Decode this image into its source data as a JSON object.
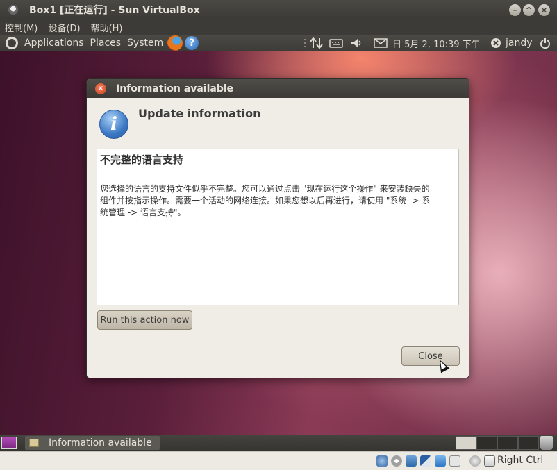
{
  "window": {
    "title": "Box1 [正在运行] - Sun VirtualBox",
    "controls": [
      "minimize",
      "maximize",
      "close"
    ]
  },
  "vbox_menu": {
    "items": [
      "控制(M)",
      "设备(D)",
      "帮助(H)"
    ]
  },
  "top_panel": {
    "applications": "Applications",
    "places": "Places",
    "system": "System",
    "clock": "日 5月 2, 10:39 下午",
    "user": "jandy",
    "help_glyph": "?"
  },
  "dialog": {
    "title": "Information available",
    "heading": "Update information",
    "content_title": "不完整的语言支持",
    "content_body_line1": "您选择的语言的支持文件似乎不完整。您可以通过点击 \"现在运行这个操作\" 来安装缺失的",
    "content_body_line2": "组件并按指示操作。需要一个活动的网络连接。如果您想以后再进行，请使用 \"系统 -> 系",
    "content_body_line3": "统管理 -> 语言支持\"。",
    "run_button": "Run this action now",
    "close_button": "Close",
    "info_glyph": "i"
  },
  "bottom_panel": {
    "task": "Information available"
  },
  "vbox_status": {
    "host_key": "Right Ctrl"
  }
}
